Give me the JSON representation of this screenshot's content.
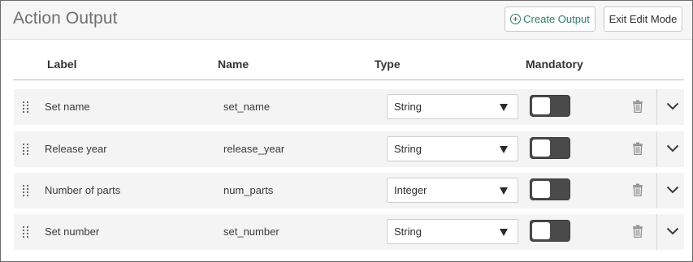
{
  "header": {
    "title": "Action Output",
    "create_button": "Create Output",
    "exit_button": "Exit Edit Mode"
  },
  "columns": {
    "label": "Label",
    "name": "Name",
    "type": "Type",
    "mandatory": "Mandatory"
  },
  "rows": [
    {
      "label": "Set name",
      "name": "set_name",
      "type": "String",
      "mandatory": false
    },
    {
      "label": "Release year",
      "name": "release_year",
      "type": "String",
      "mandatory": false
    },
    {
      "label": "Number of parts",
      "name": "num_parts",
      "type": "Integer",
      "mandatory": false
    },
    {
      "label": "Set number",
      "name": "set_number",
      "type": "String",
      "mandatory": false
    }
  ],
  "icons": {
    "create": "plus-circle-icon",
    "drag": "drag-handle-icon",
    "dropdown": "caret-down-icon",
    "delete": "trash-icon",
    "expand": "chevron-down-icon"
  },
  "colors": {
    "accent": "#2e7d6a",
    "toggle_off": "#4a4a4a"
  }
}
